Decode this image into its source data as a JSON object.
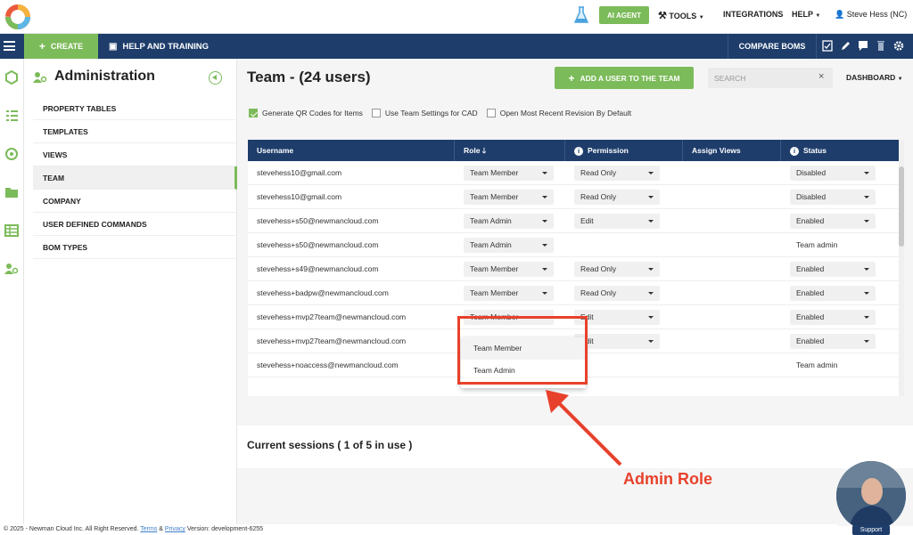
{
  "topbar": {
    "ai_agent": "AI AGENT",
    "tools": "TOOLS",
    "integrations": "INTEGRATIONS",
    "help": "HELP",
    "user": "Steve Hess (NC)"
  },
  "navbar": {
    "create": "CREATE",
    "help_training": "HELP AND TRAINING",
    "compare_boms": "COMPARE BOMS"
  },
  "admin": {
    "title": "Administration",
    "menu": [
      "PROPERTY TABLES",
      "TEMPLATES",
      "VIEWS",
      "TEAM",
      "COMPANY",
      "USER DEFINED COMMANDS",
      "BOM TYPES"
    ],
    "active": "TEAM"
  },
  "team": {
    "title": "Team - (24 users)",
    "add_button": "ADD A USER TO THE TEAM",
    "search_placeholder": "SEARCH",
    "dashboard": "DASHBOARD",
    "options": {
      "qr": "Generate QR Codes for Items",
      "cad": "Use Team Settings for CAD",
      "revision": "Open Most Recent Revision By Default"
    },
    "columns": {
      "username": "Username",
      "role": "Role",
      "permission": "Permission",
      "assign_views": "Assign Views",
      "status": "Status"
    },
    "rows": [
      {
        "username": "stevehess10@gmail.com",
        "role": "Team Member",
        "permission": "Read Only",
        "status": "Disabled"
      },
      {
        "username": "stevehess10@gmail.com",
        "role": "Team Member",
        "permission": "Read Only",
        "status": "Disabled"
      },
      {
        "username": "stevehess+s50@newmancloud.com",
        "role": "Team Admin",
        "permission": "Edit",
        "status": "Enabled"
      },
      {
        "username": "stevehess+s50@newmancloud.com",
        "role": "Team Admin",
        "permission": "",
        "status": "Team admin"
      },
      {
        "username": "stevehess+s49@newmancloud.com",
        "role": "Team Member",
        "permission": "Read Only",
        "status": "Enabled"
      },
      {
        "username": "stevehess+badpw@newmancloud.com",
        "role": "Team Member",
        "permission": "Read Only",
        "status": "Enabled"
      },
      {
        "username": "stevehess+mvp27team@newmancloud.com",
        "role": "Team Member",
        "permission": "Edit",
        "status": "Enabled"
      },
      {
        "username": "stevehess+mvp27team@newmancloud.com",
        "role": "",
        "permission": "Edit",
        "status": "Enabled"
      },
      {
        "username": "stevehess+noaccess@newmancloud.com",
        "role": "",
        "permission": "",
        "status": "Team admin"
      }
    ],
    "dropdown_options": [
      "Team Member",
      "Team Admin"
    ]
  },
  "sessions": {
    "title": "Current sessions ( 1 of 5 in use )"
  },
  "annotation": {
    "label": "Admin Role",
    "color": "#e8412b"
  },
  "support": "Support",
  "footer": {
    "copyright": "© 2025 - Newman Cloud Inc. All Right Reserved.",
    "terms": "Terms",
    "amp": "&",
    "privacy": "Privacy",
    "version": "Version: development-6255"
  },
  "colors": {
    "brand_green": "#7cbb5a",
    "navy": "#1e3d6b"
  }
}
